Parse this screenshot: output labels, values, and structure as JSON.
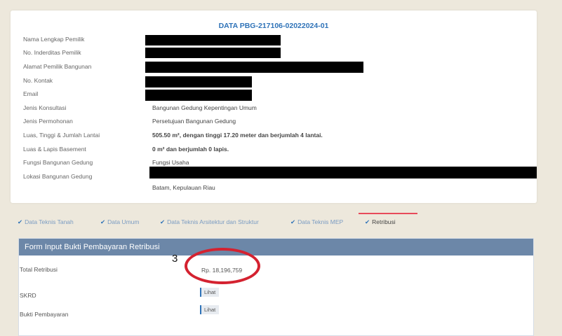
{
  "info": {
    "title": "DATA PBG-217106-02022024-01",
    "rows": [
      {
        "label": "Nama Lengkap Pemilik",
        "value": ""
      },
      {
        "label": "No. Inderditas Pemilik",
        "value": ""
      },
      {
        "label": "Alamat Pemilik Bangunan",
        "value": ""
      },
      {
        "label": "No. Kontak",
        "value": ""
      },
      {
        "label": "Email",
        "value": ""
      },
      {
        "label": "Jenis Konsultasi",
        "value": "Bangunan Gedung Kepentingan Umum"
      },
      {
        "label": "Jenis Permohonan",
        "value": "Persetujuan Bangunan Gedung"
      },
      {
        "label": "Luas, Tinggi & Jumlah Lantai",
        "value": "505.50 m², dengan tinggi 17.20 meter dan berjumlah 4 lantai."
      },
      {
        "label": "Luas & Lapis Basement",
        "value": "0 m² dan berjumlah 0 lapis."
      },
      {
        "label": "Fungsi Bangunan Gedung",
        "value": "Fungsi Usaha"
      },
      {
        "label": "Lokasi Bangunan Gedung",
        "value": ""
      }
    ],
    "location_tail": "Batam, Kepulauan Riau"
  },
  "tabs": [
    {
      "label": "Data Teknis Tanah",
      "check": "✔"
    },
    {
      "label": "Data Umum",
      "check": "✔"
    },
    {
      "label": "Data Teknis Arsitektur dan Struktur",
      "check": "✔"
    },
    {
      "label": "Data Teknis MEP",
      "check": "✔"
    },
    {
      "label": "Retribusi",
      "check": "✔"
    }
  ],
  "form": {
    "title": "Form Input Bukti Pembayaran Retribusi",
    "total_label": "Total Retribusi",
    "total_value": "Rp. 18,196,759",
    "skrd_label": "SKRD",
    "skrd_button": "Lihat",
    "bukti_label": "Bukti Pembayaran",
    "bukti_button": "Lihat"
  },
  "annotation": {
    "number": "3",
    "color": "#d42230"
  }
}
